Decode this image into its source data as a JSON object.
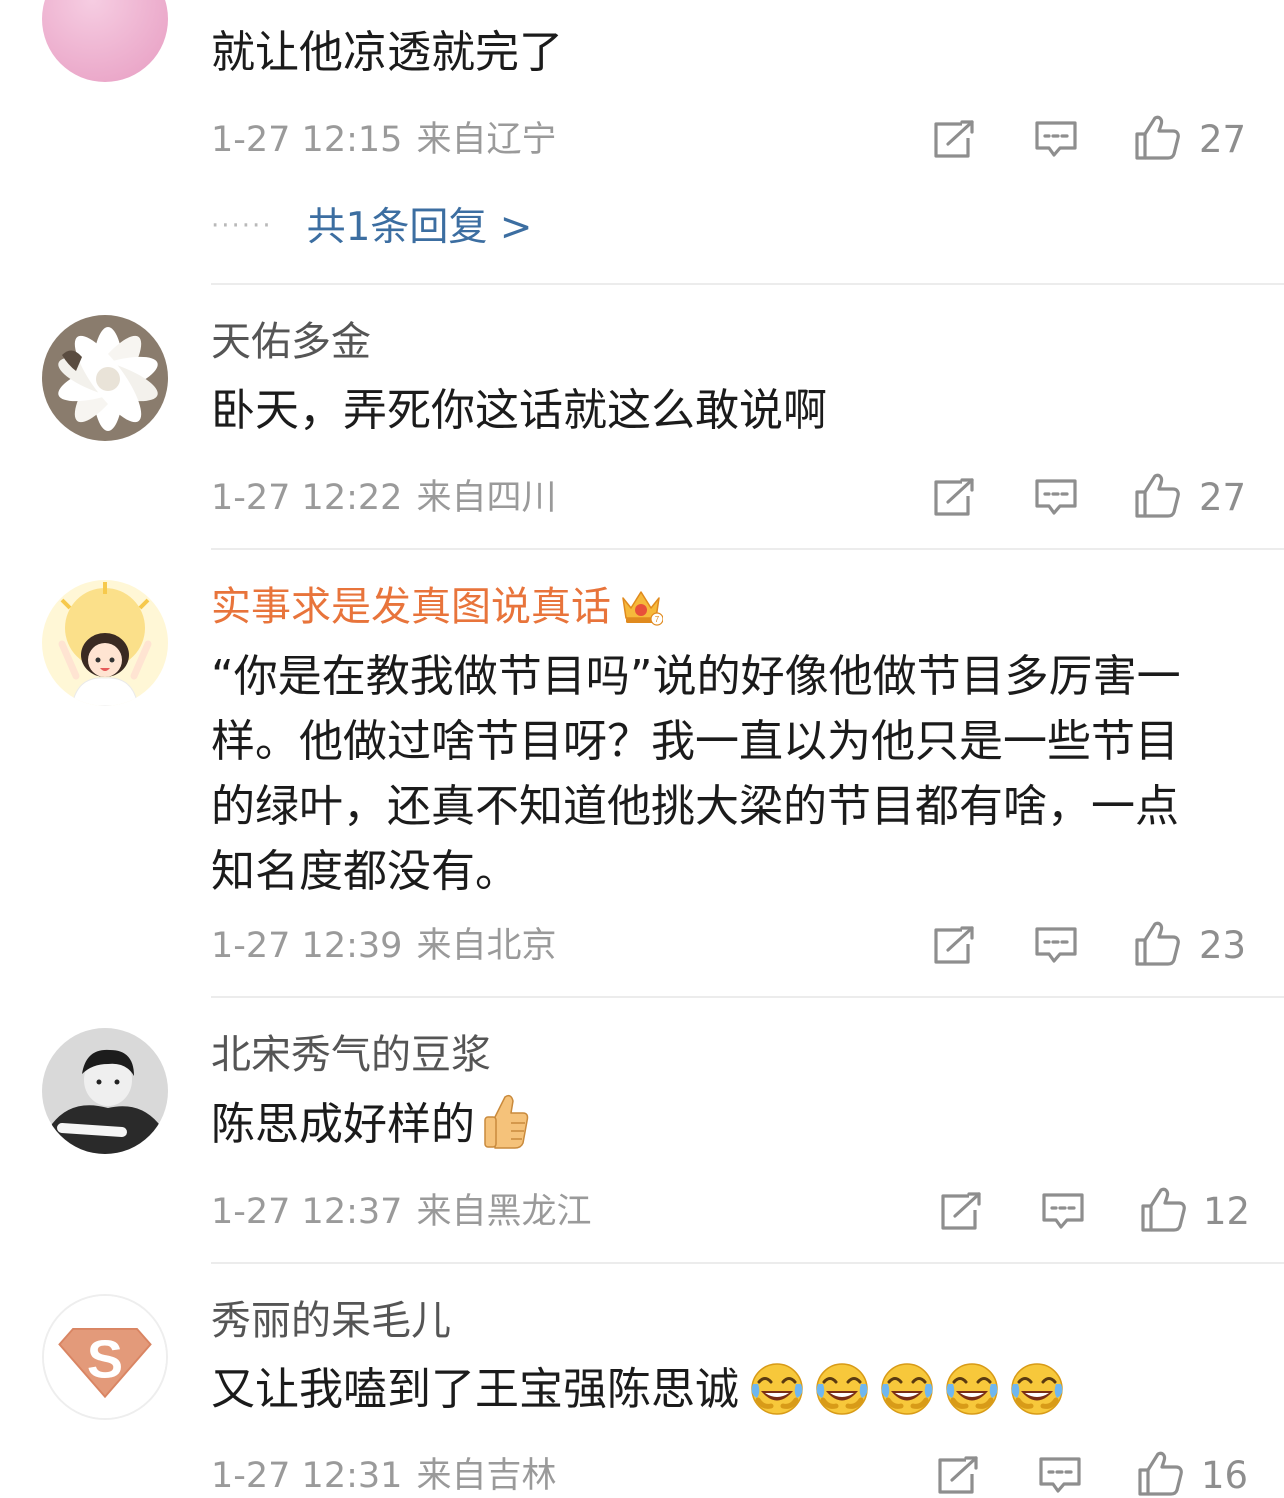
{
  "comments": [
    {
      "username": "",
      "text": "就让他凉透就完了",
      "time": "1-27 12:15",
      "location": "来自辽宁",
      "likes": "27",
      "avatar_color": "#f1b5d4",
      "replies": "共1条回复 >"
    },
    {
      "username": "天佑多金",
      "text": "卧天，弄死你这话就这么敢说啊",
      "time": "1-27 12:22",
      "location": "来自四川",
      "likes": "27",
      "avatar_color": "#8a7c6d"
    },
    {
      "username": "实事求是发真图说真话",
      "text_lines": [
        "“你是在教我做节目吗”说的好像他做节目多厉害一",
        "样。他做过啥节目呀？我一直以为他只是一些节目",
        "的绿叶，还真不知道他挑大梁的节目都有啥，一点",
        "知名度都没有。"
      ],
      "time": "1-27 12:39",
      "location": "来自北京",
      "likes": "23",
      "vip": true,
      "avatar_color": "#fbe08a"
    },
    {
      "username": "北宋秀气的豆浆",
      "text": "陈思成好样的",
      "emoji": "thumbs-up-emoji",
      "time": "1-27 12:37",
      "location": "来自黑龙江",
      "likes": "12",
      "avatar_color": "#9a9a9a"
    },
    {
      "username": "秀丽的呆毛儿",
      "text": "又让我嗑到了王宝强陈思诚",
      "emoji": "laughing-crying-emoji",
      "emoji_count": 5,
      "time": "1-27 12:31",
      "location": "来自吉林",
      "likes": "16",
      "avatar_color": "#e39a7a"
    }
  ],
  "icons": {
    "repost": "repost-icon",
    "comment": "comment-icon",
    "like": "thumb-up-icon",
    "vip_badge": "crown-icon"
  },
  "colors": {
    "vip_name": "#e8743b",
    "reply_link": "#3c6ea1",
    "meta_gray": "#9a9a9a"
  }
}
